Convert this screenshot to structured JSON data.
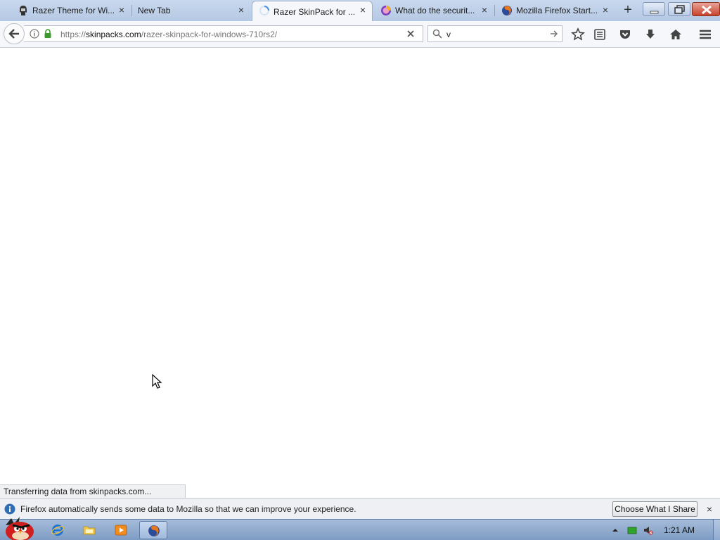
{
  "tabs": [
    {
      "title": "Razer Theme for Wi...",
      "icon": "hacker-icon",
      "active": false
    },
    {
      "title": "New Tab",
      "icon": "",
      "active": false
    },
    {
      "title": "Razer SkinPack for ...",
      "icon": "loading-spinner-icon",
      "active": true
    },
    {
      "title": "What do the securit...",
      "icon": "firefox-nightly-icon",
      "active": false
    },
    {
      "title": "Mozilla Firefox Start...",
      "icon": "firefox-icon",
      "active": false
    }
  ],
  "url": {
    "scheme": "https://",
    "host": "skinpacks.com",
    "path": "/razer-skinpack-for-windows-710rs2/"
  },
  "search": {
    "value": "v"
  },
  "status_text": "Transferring data from skinpacks.com...",
  "notification": {
    "text": "Firefox automatically sends some data to Mozilla so that we can improve your experience.",
    "button_label": "Choose What I Share"
  },
  "taskbar": {
    "apps": [
      "angry-birds-start-icon",
      "internet-explorer-icon",
      "folder-icon",
      "media-player-icon",
      "firefox-icon"
    ],
    "clock": "1:21 AM"
  },
  "colors": {
    "accent": "#4a90e2",
    "chrome": "#f5f7fa",
    "taskbar": "#8ea9cf"
  }
}
